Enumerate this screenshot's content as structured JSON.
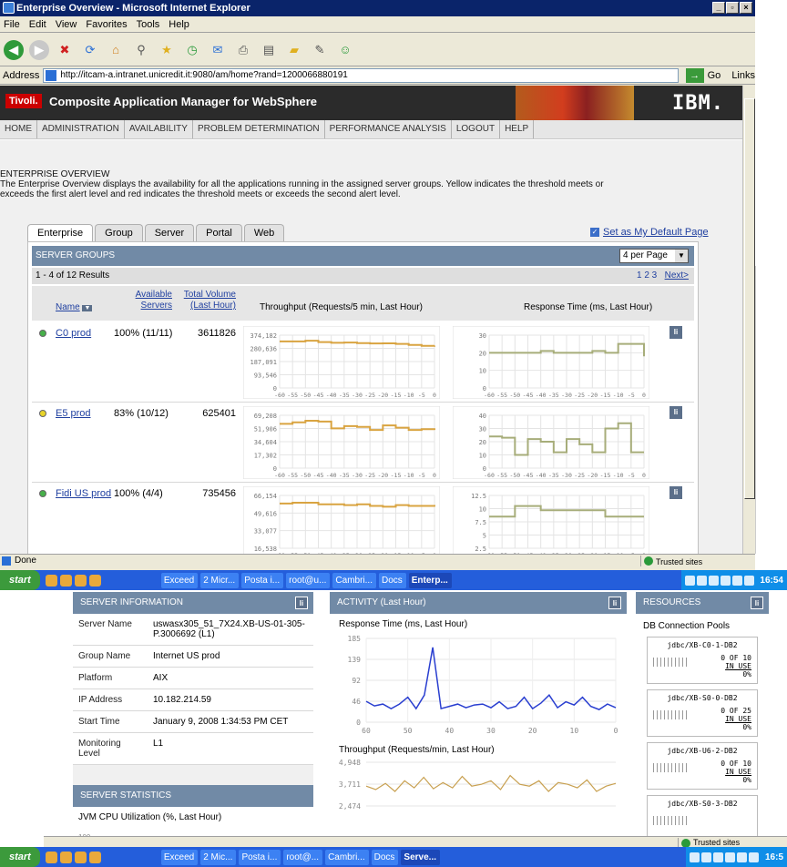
{
  "ie": {
    "title": "Enterprise Overview - Microsoft Internet Explorer",
    "menu": [
      "File",
      "Edit",
      "View",
      "Favorites",
      "Tools",
      "Help"
    ],
    "address_label": "Address",
    "url": "http://itcam-a.intranet.unicredit.it:9080/am/home?rand=1200066880191",
    "go": "Go",
    "links": "Links",
    "status": "Done",
    "zone": "Trusted sites"
  },
  "app": {
    "brand": "Tivoli.",
    "title": "Composite Application Manager for WebSphere",
    "ibm": "IBM.",
    "nav": [
      "HOME",
      "ADMINISTRATION",
      "AVAILABILITY",
      "PROBLEM DETERMINATION",
      "PERFORMANCE ANALYSIS",
      "LOGOUT",
      "HELP"
    ]
  },
  "overview": {
    "heading": "ENTERPRISE OVERVIEW",
    "desc": "The Enterprise Overview displays the availability for all the applications running in the assigned server groups. Yellow indicates the threshold meets or exceeds the first alert level and red indicates the threshold meets or exceeds the second alert level.",
    "tabs": [
      "Enterprise",
      "Group",
      "Server",
      "Portal",
      "Web"
    ],
    "default_link": "Set as My Default Page"
  },
  "groups": {
    "header": "SERVER GROUPS",
    "per_page": "4 per Page",
    "results": "1 - 4 of 12 Results",
    "pages": "1 2 3",
    "next": "Next>",
    "col_name": "Name",
    "col_avail_1": "Available",
    "col_avail_2": "Servers",
    "col_vol_1": "Total Volume",
    "col_vol_2": "(Last Hour)",
    "col_tp": "Throughput (Requests/5 min, Last Hour)",
    "col_rt": "Response Time (ms, Last Hour)",
    "rows": [
      {
        "name": "C0 prod",
        "avail": "100% (11/11)",
        "volume": "3611826",
        "status": "#46b04a",
        "tp_ticks": [
          "374,182",
          "280,636",
          "187,091",
          "93,546",
          "0"
        ],
        "tp_max": 374182,
        "tp": [
          330000,
          330000,
          335000,
          325000,
          320000,
          322000,
          318000,
          315000,
          316000,
          312000,
          305000,
          298000,
          300000
        ],
        "rt_ticks": [
          "30",
          "20",
          "10",
          "0"
        ],
        "rt_max": 30,
        "rt": [
          20,
          20,
          20,
          20,
          21,
          20,
          20,
          20,
          21,
          20,
          25,
          25,
          18
        ]
      },
      {
        "name": "E5 prod",
        "avail": "83% (10/12)",
        "volume": "625401",
        "status": "#e8d428",
        "tp_ticks": [
          "69,208",
          "51,906",
          "34,604",
          "17,302",
          "0"
        ],
        "tp_max": 69208,
        "tp": [
          58000,
          60000,
          62000,
          61000,
          52000,
          55000,
          54000,
          50000,
          56000,
          53000,
          50000,
          51000,
          50000
        ],
        "rt_ticks": [
          "40",
          "30",
          "20",
          "10",
          "0"
        ],
        "rt_max": 40,
        "rt": [
          24,
          23,
          10,
          22,
          20,
          12,
          22,
          18,
          12,
          30,
          34,
          12,
          12
        ]
      },
      {
        "name": "Fidi US prod",
        "avail": "100% (4/4)",
        "volume": "735456",
        "status": "#46b04a",
        "tp_ticks": [
          "66,154",
          "49,616",
          "33,077",
          "16,538"
        ],
        "tp_max": 66154,
        "tp": [
          56000,
          57000,
          57000,
          55000,
          55000,
          54000,
          55000,
          53000,
          52000,
          54000,
          53000,
          53000,
          52000
        ],
        "rt_ticks": [
          "12.5",
          "10",
          "7.5",
          "5",
          "2.5"
        ],
        "rt_max": 12.5,
        "rt": [
          7.5,
          7.5,
          10,
          10,
          9,
          9,
          9,
          9,
          9,
          7.5,
          7.5,
          7.5,
          7.5
        ]
      }
    ],
    "x_ticks": [
      "-60",
      "-55",
      "-50",
      "-45",
      "-40",
      "-35",
      "-30",
      "-25",
      "-20",
      "-15",
      "-10",
      "-5",
      "0"
    ]
  },
  "taskbar": {
    "start": "start",
    "items": [
      "Exceed",
      "2 Micr...",
      "Posta i...",
      "root@u...",
      "Cambri...",
      "Docs",
      "Enterp..."
    ],
    "items2": [
      "Exceed",
      "2 Mic...",
      "Posta i...",
      "root@...",
      "Cambri...",
      "Docs",
      "Serve..."
    ],
    "clock": "16:54",
    "clock2": "16:5"
  },
  "server_info": {
    "header": "SERVER INFORMATION",
    "rows": [
      {
        "k": "Server Name",
        "v": "uswasx305_51_7X24.XB-US-01-305-P.3006692 (L1)"
      },
      {
        "k": "Group Name",
        "v": "Internet US prod"
      },
      {
        "k": "Platform",
        "v": "AIX"
      },
      {
        "k": "IP Address",
        "v": "10.182.214.59"
      },
      {
        "k": "Start Time",
        "v": "January 9, 2008 1:34:53 PM CET"
      },
      {
        "k": "Monitoring Level",
        "v": "L1"
      }
    ],
    "stats_header": "SERVER STATISTICS",
    "cpu_label": "JVM CPU Utilization (%, Last Hour)",
    "cpu_tick": "100"
  },
  "activity": {
    "header": "ACTIVITY (Last Hour)",
    "rt_label": "Response Time (ms, Last Hour)",
    "rt_ticks": [
      "185",
      "139",
      "92",
      "46",
      "0"
    ],
    "rt_x": [
      "60",
      "50",
      "40",
      "30",
      "20",
      "10",
      "0"
    ],
    "tp_label": "Throughput (Requests/min, Last Hour)",
    "tp_ticks": [
      "4,948",
      "3,711",
      "2,474"
    ]
  },
  "resources": {
    "header": "RESOURCES",
    "sub": "DB Connection Pools",
    "pools": [
      {
        "name": "jdbc/XB-C0-1-DB2",
        "use": "0 OF 10",
        "inuse": "IN USE",
        "pct": "0%"
      },
      {
        "name": "jdbc/XB-S0-0-DB2",
        "use": "0 OF 25",
        "inuse": "IN USE",
        "pct": "0%"
      },
      {
        "name": "jdbc/XB-U6-2-DB2",
        "use": "0 OF 10",
        "inuse": "IN USE",
        "pct": "0%"
      },
      {
        "name": "jdbc/XB-S0-3-DB2",
        "use": "",
        "inuse": "",
        "pct": ""
      }
    ]
  },
  "chart_data": {
    "type": "line",
    "title": "Response Time (ms, Last Hour)",
    "x": [
      60,
      58,
      56,
      54,
      52,
      50,
      48,
      46,
      44,
      42,
      40,
      38,
      36,
      34,
      32,
      30,
      28,
      26,
      24,
      22,
      20,
      18,
      16,
      14,
      12,
      10,
      8,
      6,
      4,
      2,
      0
    ],
    "values": [
      46,
      36,
      40,
      30,
      40,
      55,
      30,
      60,
      165,
      30,
      35,
      40,
      32,
      38,
      40,
      32,
      45,
      30,
      35,
      55,
      30,
      42,
      60,
      32,
      45,
      38,
      55,
      35,
      28,
      40,
      32
    ],
    "ylim": [
      0,
      185
    ],
    "tp_values": [
      3600,
      3400,
      3750,
      3300,
      3900,
      3500,
      4100,
      3450,
      3800,
      3500,
      4150,
      3600,
      3700,
      3900,
      3400,
      4200,
      3700,
      3600,
      3900,
      3300,
      3800,
      3700,
      3500,
      3950,
      3300,
      3600,
      3750
    ]
  }
}
